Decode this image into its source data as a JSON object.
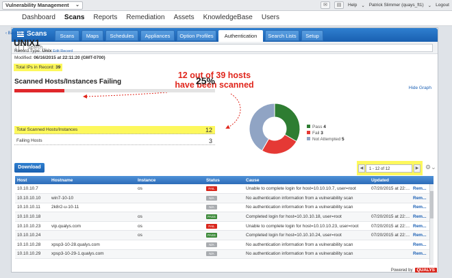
{
  "topbar": {
    "app_name": "Vulnerability Management",
    "help": "Help",
    "user": "Patrick Slimmer (quays_ft1)",
    "logout": "Logout"
  },
  "mainnav": [
    "Dashboard",
    "Scans",
    "Reports",
    "Remediation",
    "Assets",
    "KnowledgeBase",
    "Users"
  ],
  "module": {
    "title": "Scans",
    "tabs": [
      "Scans",
      "Maps",
      "Schedules",
      "Appliances",
      "Option Profiles",
      "Authentication",
      "Search Lists",
      "Setup"
    ],
    "active_tab": "Authentication"
  },
  "search": {
    "placeholder": "Search..."
  },
  "record": {
    "back_link": "Back to List",
    "title": "UNIX1",
    "record_type_label": "Record Type:",
    "record_type_value": "Unix",
    "edit_link": "Edit Record",
    "modified_label": "Modified:",
    "modified_value": "06/16/2015 at 22:11:20 (GMT-0700)",
    "total_ips_label": "Total IPs in Record:",
    "total_ips_value": "39",
    "hide_graph": "Hide Graph"
  },
  "callout": {
    "line1": "12 out of 39 hosts",
    "line2": "have been scanned"
  },
  "summary": {
    "title": "Scanned Hosts/Instances Failing",
    "percent": "25%",
    "fill_fraction": 0.25,
    "rows": [
      {
        "label": "Total Scanned Hosts/Instances",
        "value": "12"
      },
      {
        "label": "Failing Hosts",
        "value": "3"
      }
    ]
  },
  "chart_data": {
    "type": "pie",
    "labels": [
      "Pass",
      "Fail",
      "Not Attempted"
    ],
    "values": [
      4,
      3,
      5
    ],
    "colors": [
      "#2e7d32",
      "#e53935",
      "#90a4c4"
    ]
  },
  "toolbar": {
    "download": "Download",
    "pager_text": "1 - 12 of 12"
  },
  "table": {
    "columns": [
      "Host",
      "Hostname",
      "Instance",
      "Status",
      "Cause",
      "Updated",
      ""
    ],
    "rows": [
      [
        "10.10.10.7",
        "",
        "os",
        "FAIL",
        "Unable to complete login for host=10.10.10.7, user=root",
        "07/20/2015 at 22:...",
        "Rem..."
      ],
      [
        "10.10.10.10",
        "win7-10-10",
        "",
        "N/A",
        "No authentication information from a vulnerability scan",
        "",
        "Rem..."
      ],
      [
        "10.10.10.11",
        "2k8r2-u-10-11",
        "",
        "N/A",
        "No authentication information from a vulnerability scan",
        "",
        "Rem..."
      ],
      [
        "10.10.10.18",
        "",
        "os",
        "PASS",
        "Completed login for host=10.10.10.18, user=root",
        "07/20/2015 at 22:...",
        "Rem..."
      ],
      [
        "10.10.10.23",
        "vip.qualys.com",
        "os",
        "FAIL",
        "Unable to complete login for host=10.10.10.23, user=root",
        "07/20/2015 at 22:...",
        "Rem..."
      ],
      [
        "10.10.10.24",
        "",
        "os",
        "PASS",
        "Completed login for host=10.10.10.24, user=root",
        "07/20/2015 at 22:...",
        "Rem..."
      ],
      [
        "10.10.10.28",
        "xpsp3-10-28.qualys.com",
        "",
        "N/A",
        "No authentication information from a vulnerability scan",
        "",
        "Rem..."
      ],
      [
        "10.10.10.29",
        "xpsp3-10-29-1.qualys.com",
        "",
        "N/A",
        "No authentication information from a vulnerability scan",
        "",
        "Rem..."
      ]
    ]
  },
  "footer": {
    "powered_by": "Powered by",
    "brand": "QUALYS"
  }
}
